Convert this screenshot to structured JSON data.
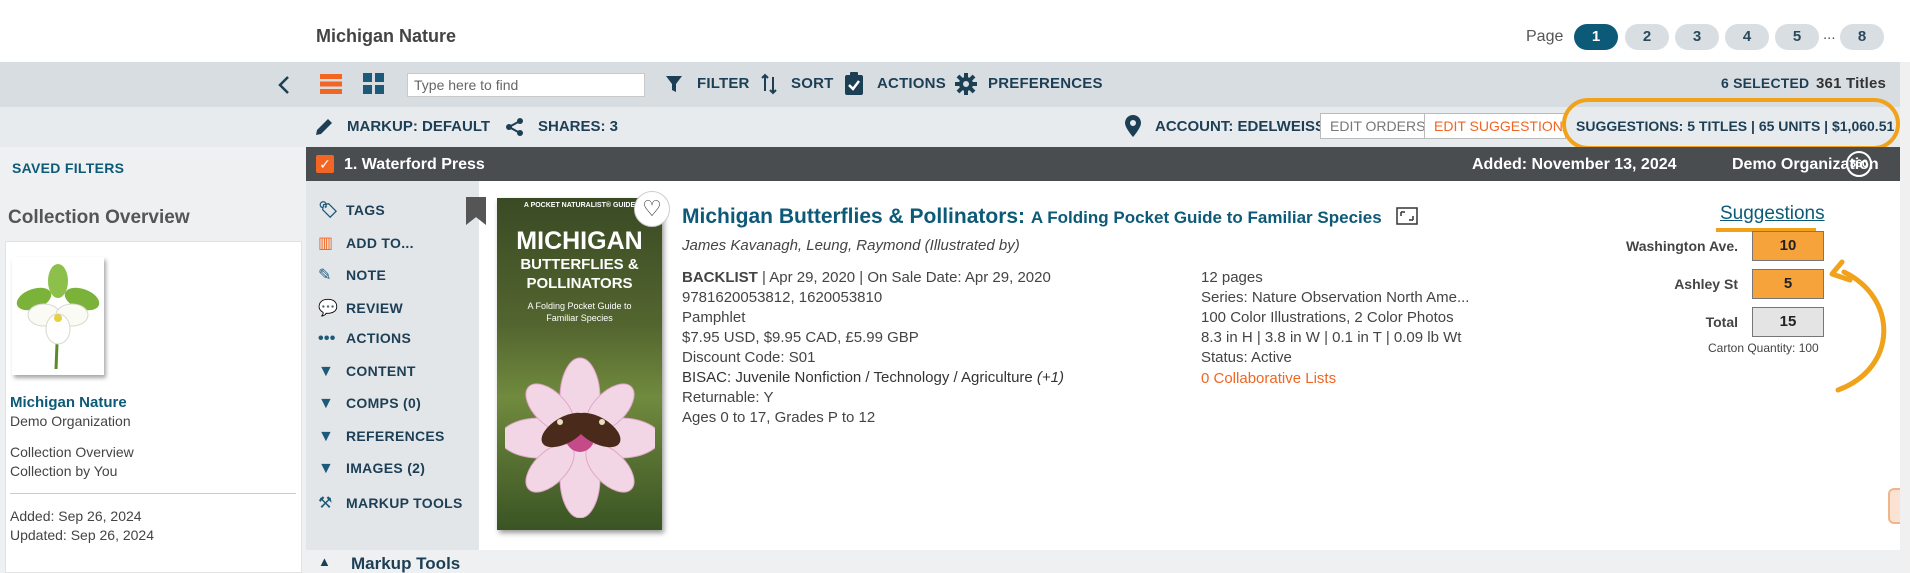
{
  "header": {
    "collection_title": "Michigan Nature",
    "page_label": "Page",
    "pages": [
      "1",
      "2",
      "3",
      "4",
      "5",
      "8"
    ],
    "page_ellipsis": "...",
    "active_page": "1"
  },
  "toolbar": {
    "search_placeholder": "Type here to find",
    "filter": "FILTER",
    "sort": "SORT",
    "actions": "ACTIONS",
    "preferences": "PREFERENCES",
    "selected": "6 SELECTED",
    "titles": "361 Titles"
  },
  "bar2": {
    "markup": "MARKUP: DEFAULT",
    "shares": "SHARES: 3",
    "account": "ACCOUNT: EDELWEISS",
    "edit_orders": "EDIT ORDERS",
    "edit_suggestions": "EDIT SUGGESTIONS",
    "suggestions_summary": "SUGGESTIONS: 5 TITLES | 65 UNITS | $1,060.51"
  },
  "sidebar": {
    "saved_filters": "SAVED FILTERS",
    "overview_heading": "Collection Overview",
    "collection_name": "Michigan Nature",
    "organization": "Demo Organization",
    "line1": "Collection Overview",
    "line2": "Collection by You",
    "added": "Added: Sep 26, 2024",
    "updated": "Updated: Sep 26, 2024"
  },
  "record": {
    "title": "1. Waterford Press",
    "added": "Added: November 13, 2024",
    "org": "Demo Organization",
    "badge": "360"
  },
  "actions": [
    {
      "label": "TAGS",
      "icon": "tag-icon"
    },
    {
      "label": "ADD TO...",
      "icon": "books-icon"
    },
    {
      "label": "NOTE",
      "icon": "pencil-icon"
    },
    {
      "label": "REVIEW",
      "icon": "speech-bubble-icon"
    },
    {
      "label": "ACTIONS",
      "icon": "dots-icon"
    },
    {
      "label": "CONTENT",
      "icon": "triangle-down-icon"
    },
    {
      "label": "COMPS (0)",
      "icon": "triangle-down-icon"
    },
    {
      "label": "REFERENCES",
      "icon": "triangle-down-icon"
    },
    {
      "label": "IMAGES (2)",
      "icon": "triangle-down-icon"
    },
    {
      "label": "MARKUP TOOLS",
      "icon": "tools-icon"
    }
  ],
  "cover": {
    "top_text": "A POCKET NATURALIST® GUIDE",
    "title1": "MICHIGAN",
    "title2": "BUTTERFLIES &",
    "title3": "POLLINATORS",
    "subtitle": "A Folding Pocket Guide to Familiar Species"
  },
  "book": {
    "title": "Michigan Butterflies & Pollinators:",
    "subtitle": "A Folding Pocket Guide to Familiar Species",
    "authors": "James Kavanagh, Leung, Raymond (Illustrated by)",
    "status_label": "BACKLIST",
    "dates": " | Apr 29, 2020 | On Sale Date: Apr 29, 2020",
    "isbn": "9781620053812, 1620053810",
    "format": "Pamphlet",
    "price": "$7.95 USD, $9.95 CAD, £5.99 GBP",
    "discount": "Discount Code: S01",
    "bisac": "BISAC: Juvenile Nonfiction / Technology / Agriculture",
    "bisac_more": "(+1)",
    "returnable": "Returnable: Y",
    "ages": "Ages 0 to 17, Grades P to 12",
    "pages": "12 pages",
    "series": "Series: Nature Observation North Ame...",
    "illustrations": "100 Color Illustrations, 2 Color Photos",
    "dimensions": "8.3 in H | 3.8 in W | 0.1 in T | 0.09 lb Wt",
    "status": "Status: Active",
    "collab": "0 Collaborative Lists"
  },
  "suggestions": {
    "heading": "Suggestions",
    "rows": [
      {
        "label": "Washington Ave.",
        "qty": "10"
      },
      {
        "label": "Ashley St",
        "qty": "5"
      },
      {
        "label": "Total",
        "qty": "15"
      }
    ],
    "carton": "Carton Quantity: 100"
  },
  "bottom": {
    "markup_tools": "Markup Tools"
  },
  "colors": {
    "accent_orange": "#f7a33b",
    "brand_teal": "#0d5a78",
    "highlight": "#f0a31a"
  }
}
